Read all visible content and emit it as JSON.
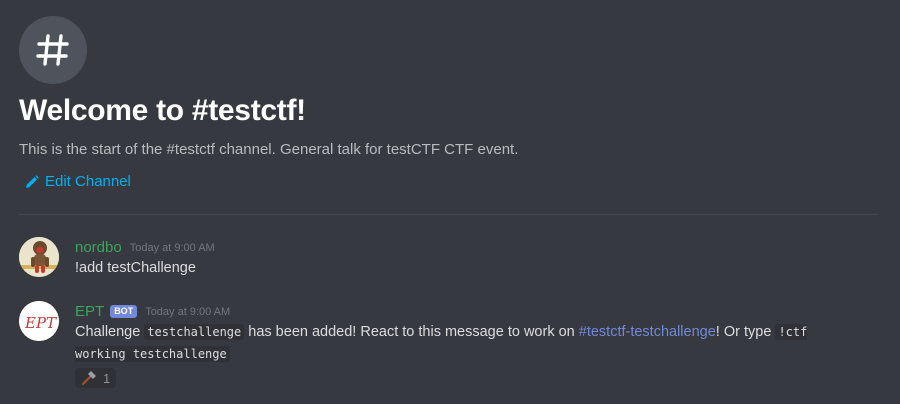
{
  "channel": {
    "icon": "hash-icon",
    "welcome_title": "Welcome to #testctf!",
    "description": "This is the start of the #testctf channel. General talk for testCTF CTF event.",
    "edit_label": "Edit Channel"
  },
  "messages": [
    {
      "author": "nordbo",
      "timestamp": "Today at 9:00 AM",
      "text": "!add testChallenge"
    },
    {
      "author": "EPT",
      "bot_tag": "BOT",
      "timestamp": "Today at 9:00 AM",
      "avatar_text": "EPT",
      "content": {
        "part1": "Challenge ",
        "code1": "testchallenge",
        "part2": " has been added! React to this message to work on ",
        "mention": "#testctf-testchallenge",
        "part3": "! Or type ",
        "code2": "!ctf",
        "code3": "working",
        "code4": "testchallenge"
      },
      "reaction": {
        "icon": "hammer-icon",
        "count": "1"
      }
    }
  ],
  "colors": {
    "background": "#36393f",
    "link": "#00b0f4",
    "username_green": "#3ba55d",
    "bot_tag": "#7289da",
    "mention": "#7289da"
  }
}
